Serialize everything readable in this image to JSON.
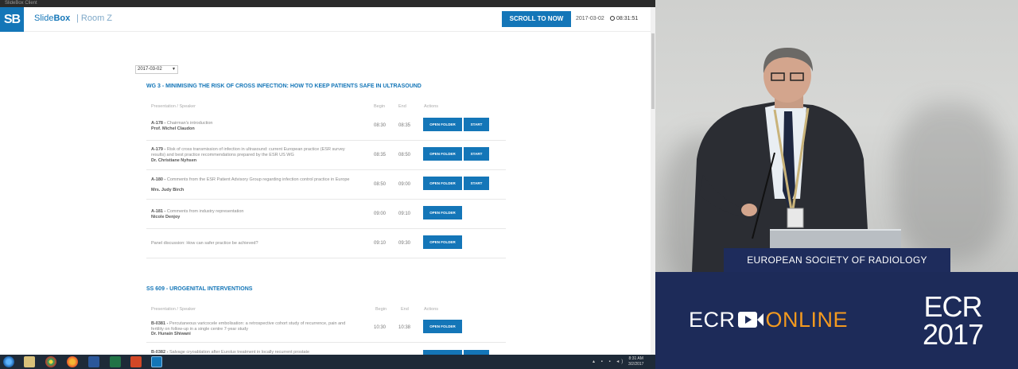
{
  "window": {
    "title": "SlideBox Client"
  },
  "header": {
    "logo": "SB",
    "app_name_prefix": "Slide",
    "app_name_bold": "Box",
    "room": "| Room Z",
    "scroll_button": "SCROLL TO NOW",
    "date": "2017-03-02",
    "time": "08:31:51"
  },
  "date_select": {
    "value": "2017-03-02"
  },
  "sessions": [
    {
      "title": "WG 3 - MINIMISING THE RISK OF CROSS INFECTION: HOW TO KEEP PATIENTS SAFE IN ULTRASOUND",
      "columns": {
        "presentation": "Presentation / Speaker",
        "begin": "Begin",
        "end": "End",
        "actions": "Actions"
      },
      "rows": [
        {
          "code": "A-178 -",
          "title": "Chairman's introduction",
          "speaker": "Prof. Michel Claudon",
          "begin": "08:30",
          "end": "08:35",
          "open": "OPEN FOLDER",
          "start": "START"
        },
        {
          "code": "A-179 -",
          "title": "Risk of cross transmission of infection in ultrasound: current European practice (ESR survey results) and best practice recommendations prepared by the ESR US WG",
          "speaker": "Dr. Christiane Nyhsen",
          "begin": "08:35",
          "end": "08:50",
          "open": "OPEN FOLDER",
          "start": "START"
        },
        {
          "code": "A-180 -",
          "title": "Comments from the ESR Patient Advisory Group regarding infection control practice in Europe",
          "speaker": "Mrs. Judy Birch",
          "begin": "08:50",
          "end": "09:00",
          "open": "OPEN FOLDER",
          "start": "START"
        },
        {
          "code": "A-181 -",
          "title": "Comments from industry representation",
          "speaker": "Nicole Denjoy",
          "begin": "09:00",
          "end": "09:10",
          "open": "OPEN FOLDER",
          "start": ""
        },
        {
          "code": "",
          "title": "Panel discussion: How can safer practice be achieved?",
          "speaker": "",
          "begin": "09:10",
          "end": "09:30",
          "open": "OPEN FOLDER",
          "start": ""
        }
      ]
    },
    {
      "title": "SS 609 - UROGENITAL INTERVENTIONS",
      "columns": {
        "presentation": "Presentation / Speaker",
        "begin": "Begin",
        "end": "End",
        "actions": "Actions"
      },
      "rows": [
        {
          "code": "B-0381 -",
          "title": "Percutaneous varicocele embolisation: a retrospective cohort study of recurrence, pain and fertility on follow-up in a single centre 7-year study",
          "speaker": "Dr. Hunain Shiwani",
          "begin": "10:30",
          "end": "10:38",
          "open": "OPEN FOLDER",
          "start": ""
        },
        {
          "code": "B-0382 -",
          "title": "Salvage cryoablation after Eurolux treatment in locally recurrent prostate",
          "speaker": "",
          "begin": "",
          "end": "",
          "open": "",
          "start": ""
        }
      ]
    }
  ],
  "taskbar": {
    "time": "8:31 AM",
    "date": "3/2/2017"
  },
  "video": {
    "podium_text": "EUROPEAN SOCIETY OF RADIOLOGY",
    "brand_ecr": "ECR",
    "brand_online": "ONLINE",
    "year_top": "ECR",
    "year_bottom": "2017"
  },
  "colors": {
    "accent": "#1476b8",
    "banner": "#1d2b59",
    "online": "#f39a1f"
  }
}
